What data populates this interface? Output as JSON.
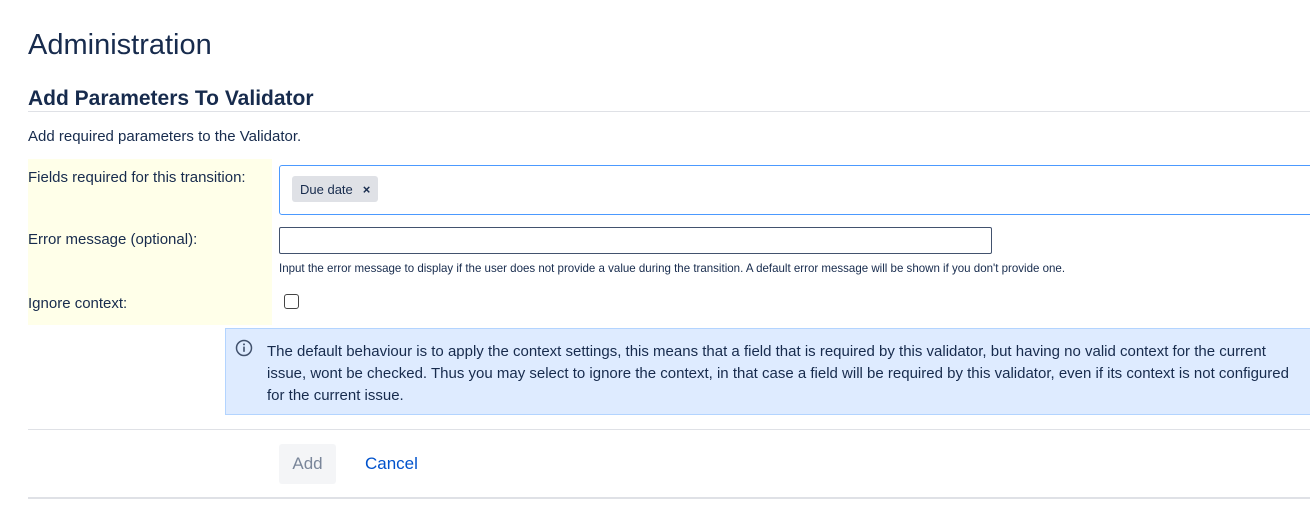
{
  "page": {
    "title": "Administration",
    "subtitle": "Add Parameters To Validator",
    "description": "Add required parameters to the Validator."
  },
  "form": {
    "fields_label": "Fields required for this transition:",
    "fields_tags": [
      {
        "label": "Due date",
        "remove_glyph": "×"
      }
    ],
    "error_label": "Error message (optional):",
    "error_value": "",
    "error_help": "Input the error message to display if the user does not provide a value during the transition. A default error message will be shown if you don't provide one.",
    "ignore_label": "Ignore context:",
    "ignore_checked": false
  },
  "info": {
    "icon": "info-icon",
    "text": "The default behaviour is to apply the context settings, this means that a field that is required by this validator, but having no valid context for the current issue, wont be checked. Thus you may select to ignore the context, in that case a field will be required by this validator, even if its context is not configured for the current issue."
  },
  "actions": {
    "add_label": "Add",
    "cancel_label": "Cancel"
  },
  "colors": {
    "accent": "#0052cc",
    "focus_border": "#4c9aff",
    "info_background": "#deebff",
    "label_background": "#ffffe9"
  }
}
